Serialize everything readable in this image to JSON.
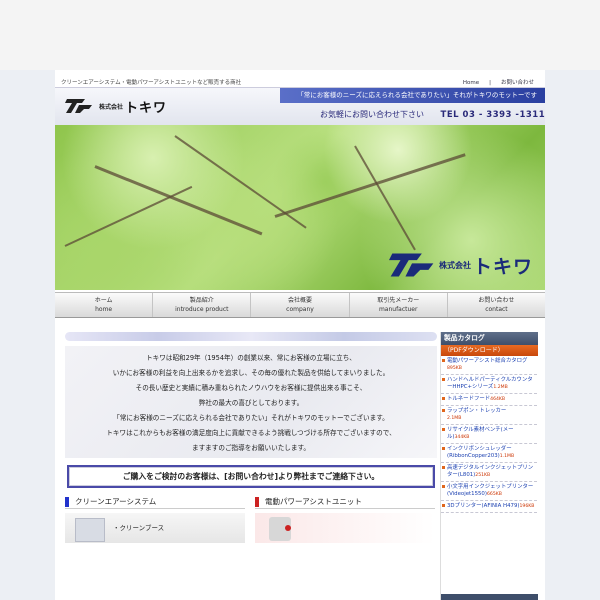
{
  "site": {
    "tagline": "クリーンエアーシステム・電動パワーアシストユニットなど販売する商社",
    "top_links": [
      "Home",
      "お問い合わせ"
    ],
    "logo_small": "株式会社",
    "logo_big": "トキワ",
    "slogan": "「常にお客様のニーズに応えられる会社でありたい」それがトキワのモットーです",
    "contact_prompt": "お気軽にお問い合わせ下さい",
    "tel": "TEL  03 - 3393 -1311"
  },
  "nav": [
    {
      "ja": "ホーム",
      "en": "home"
    },
    {
      "ja": "製品紹介",
      "en": "introduce product"
    },
    {
      "ja": "会社概要",
      "en": "company"
    },
    {
      "ja": "取引先メーカー",
      "en": "manufactuer"
    },
    {
      "ja": "お問い合わせ",
      "en": "contact"
    }
  ],
  "intro": [
    "トキワは昭和29年（1954年）の創業以来、常にお客様の立場に立ち、",
    "いかにお客様の利益を向上出来るかを追求し、その毎の優れた製品を供給してまいりました。",
    "その長い歴史と実績に積み重ねられたノウハウをお客様に提供出来る事こそ、",
    "弊社の最大の喜びとしております。",
    "「常にお客様のニーズに応えられる会社でありたい」それがトキワのモットーでございます。",
    "トキワはこれからもお客様の満足度向上に貢献できるよう挑戦しつづける所存でございますので、",
    "ますますのご指導をお願いいたします。"
  ],
  "notice": "ご購入をご検討のお客様は、[お問い合わせ]より弊社までご連絡下さい。",
  "categories": {
    "clean": "クリーンエアーシステム",
    "power": "電動パワーアシストユニット",
    "clean_item": "・クリーンブース"
  },
  "sidebar": {
    "title": "製品カタログ",
    "pdf": "（PDFダウンロード）",
    "items": [
      {
        "label": "電動パワーアシスト総合カタログ",
        "size": "895KB"
      },
      {
        "label": "ハンドヘルドパーティクルカウンターHHPC+シリーズ",
        "size": "1.2MB"
      },
      {
        "label": "トルネードフード",
        "size": "464KB"
      },
      {
        "label": "ラップポン・トレッカー",
        "size": "2.1MB"
      },
      {
        "label": "リサイクル素材ベンチ(メール)",
        "size": "344KB"
      },
      {
        "label": "インクリボンシュレッダー(RibbonCopper203)",
        "size": "1.1MB"
      },
      {
        "label": "高速デジタルインクジェットプリンター(L801)",
        "size": "251KB"
      },
      {
        "label": "小文字用インクジェットプリンター(Videojet1550)",
        "size": "665KB"
      },
      {
        "label": "3Dプリンター(AFINIA H479)",
        "size": "196KB"
      }
    ]
  },
  "colors": {
    "brand_blue": "#1a2a7a",
    "slogan_bg": "#2a3fa0",
    "pdf_orange": "#e86a22",
    "clean_marker": "#2233cc",
    "power_marker": "#cc2222"
  }
}
